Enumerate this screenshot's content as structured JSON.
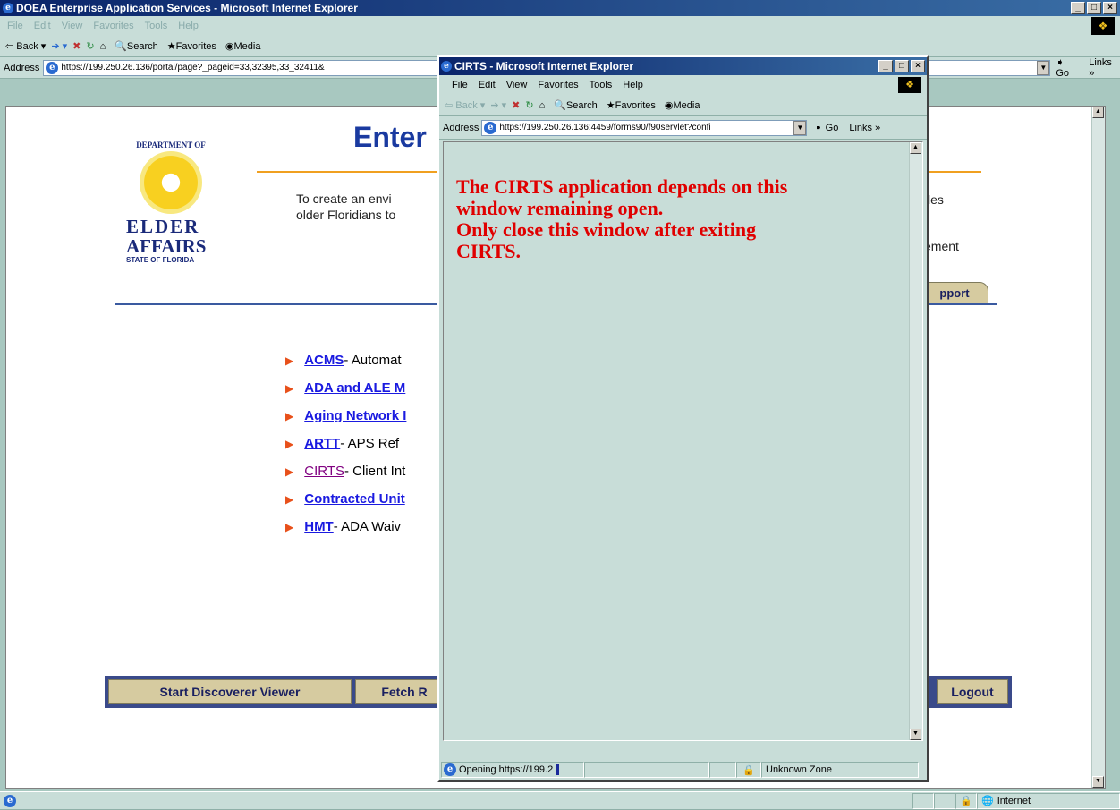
{
  "outer": {
    "title": "DOEA Enterprise Application Services - Microsoft Internet Explorer",
    "menu": [
      "File",
      "Edit",
      "View",
      "Favorites",
      "Tools",
      "Help"
    ],
    "toolbar": {
      "back": "Back",
      "search": "Search",
      "favorites": "Favorites",
      "media": "Media"
    },
    "address_label": "Address",
    "address": "https://199.250.26.136/portal/page?_pageid=33,32395,33_32411&",
    "go": "Go",
    "links": "Links",
    "status_zone": "Internet"
  },
  "page": {
    "dept_of": "DEPARTMENT OF",
    "logo_elder": "ELDER",
    "logo_affairs": "AFFAIRS",
    "logo_state": "STATE OF FLORIDA",
    "heading_visible": "Enter",
    "mission_line1": "To create an envi",
    "mission_line2": "older Floridians to",
    "mission_tail1": "les",
    "mission_tail2": "ement",
    "support_tab": "pport",
    "apps": [
      {
        "name": "ACMS",
        "desc": " - Automat"
      },
      {
        "name": "ADA and ALE M",
        "desc": ""
      },
      {
        "name": "Aging Network I",
        "desc": ""
      },
      {
        "name": "ARTT",
        "desc": " - APS Ref"
      },
      {
        "name": "CIRTS",
        "desc": " - Client Int"
      },
      {
        "name": "Contracted Unit",
        "desc": ""
      },
      {
        "name": "HMT",
        "desc": " - ADA Waiv"
      }
    ],
    "bottom_nav": {
      "discoverer": "Start Discoverer Viewer",
      "fetch": "Fetch R",
      "logout": "Logout"
    }
  },
  "popup": {
    "title": "CIRTS - Microsoft Internet Explorer",
    "menu": [
      "File",
      "Edit",
      "View",
      "Favorites",
      "Tools",
      "Help"
    ],
    "toolbar": {
      "back": "Back",
      "search": "Search",
      "favorites": "Favorites",
      "media": "Media"
    },
    "address_label": "Address",
    "address": "https://199.250.26.136:4459/forms90/f90servlet?confi",
    "go": "Go",
    "links": "Links",
    "message": [
      "The CIRTS application depends on this",
      "window remaining open.",
      "Only close this window after exiting",
      "CIRTS."
    ],
    "status_text": "Opening https://199.2",
    "zone": "Unknown Zone"
  },
  "colors": {
    "title_bar": "#0a246a",
    "popup_bg": "#c8ddd8",
    "message": "#e00000",
    "link": "#1a1ae0",
    "visited": "#800080",
    "accent_line": "#f0a020",
    "nav_bg": "#d6cba0"
  }
}
